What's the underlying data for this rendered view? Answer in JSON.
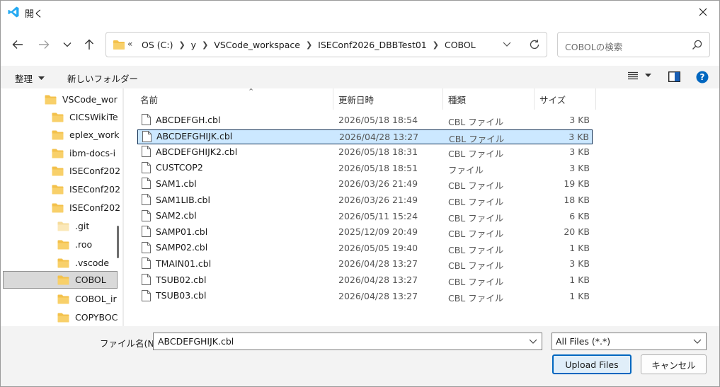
{
  "window": {
    "title": "開く"
  },
  "address": {
    "overflow": "«",
    "crumbs": [
      "OS (C:)",
      "y",
      "VSCode_workspace",
      "ISEConf2026_DBBTest01",
      "COBOL"
    ]
  },
  "search": {
    "placeholder": "COBOLの検索"
  },
  "toolbar": {
    "organize_label": "整理",
    "new_folder_label": "新しいフォルダー"
  },
  "tree": {
    "items": [
      {
        "label": "VSCode_wor",
        "icon": "folder-icon"
      },
      {
        "label": "CICSWikiTe",
        "icon": "folder-icon"
      },
      {
        "label": "eplex_work",
        "icon": "folder-icon"
      },
      {
        "label": "ibm-docs-i",
        "icon": "folder-icon"
      },
      {
        "label": "ISEConf202",
        "icon": "folder-icon"
      },
      {
        "label": "ISEConf202",
        "icon": "folder-icon"
      },
      {
        "label": "ISEConf202",
        "icon": "folder-icon"
      },
      {
        "label": ".git",
        "icon": "folder-light-icon"
      },
      {
        "label": ".roo",
        "icon": "folder-icon"
      },
      {
        "label": ".vscode",
        "icon": "folder-icon"
      },
      {
        "label": "COBOL",
        "icon": "folder-icon",
        "selected": true
      },
      {
        "label": "COBOL_ir",
        "icon": "folder-icon"
      },
      {
        "label": "COPYBOC",
        "icon": "folder-icon"
      }
    ]
  },
  "columns": {
    "name": "名前",
    "date": "更新日時",
    "type": "種類",
    "size": "サイズ"
  },
  "files": [
    {
      "name": "ABCDEFGH.cbl",
      "date": "2026/05/18 18:54",
      "type": "CBL ファイル",
      "size": "3 KB"
    },
    {
      "name": "ABCDEFGHIJK.cbl",
      "date": "2026/04/28 13:27",
      "type": "CBL ファイル",
      "size": "3 KB",
      "selected": true
    },
    {
      "name": "ABCDEFGHIJK2.cbl",
      "date": "2026/05/18 18:31",
      "type": "CBL ファイル",
      "size": "3 KB"
    },
    {
      "name": "CUSTCOP2",
      "date": "2026/05/18 18:51",
      "type": "ファイル",
      "size": "3 KB"
    },
    {
      "name": "SAM1.cbl",
      "date": "2026/03/26 21:49",
      "type": "CBL ファイル",
      "size": "19 KB"
    },
    {
      "name": "SAM1LIB.cbl",
      "date": "2026/03/26 21:49",
      "type": "CBL ファイル",
      "size": "18 KB"
    },
    {
      "name": "SAM2.cbl",
      "date": "2026/05/11 15:24",
      "type": "CBL ファイル",
      "size": "6 KB"
    },
    {
      "name": "SAMP01.cbl",
      "date": "2025/12/09 20:49",
      "type": "CBL ファイル",
      "size": "20 KB"
    },
    {
      "name": "SAMP02.cbl",
      "date": "2026/05/05 19:40",
      "type": "CBL ファイル",
      "size": "1 KB"
    },
    {
      "name": "TMAIN01.cbl",
      "date": "2026/04/28 13:27",
      "type": "CBL ファイル",
      "size": "3 KB"
    },
    {
      "name": "TSUB02.cbl",
      "date": "2026/04/28 13:27",
      "type": "CBL ファイル",
      "size": "1 KB"
    },
    {
      "name": "TSUB03.cbl",
      "date": "2026/04/28 13:27",
      "type": "CBL ファイル",
      "size": "1 KB"
    }
  ],
  "filename": {
    "label": "ファイル名(N):",
    "value": "ABCDEFGHIJK.cbl"
  },
  "filter": {
    "value": "All Files (*.*)"
  },
  "buttons": {
    "upload": "Upload Files",
    "cancel": "キャンセル"
  },
  "colors": {
    "accent": "#0067c0",
    "folder": "#f3c14b",
    "selection": "#cce8ff",
    "vscode_blue": "#23a9f2"
  }
}
